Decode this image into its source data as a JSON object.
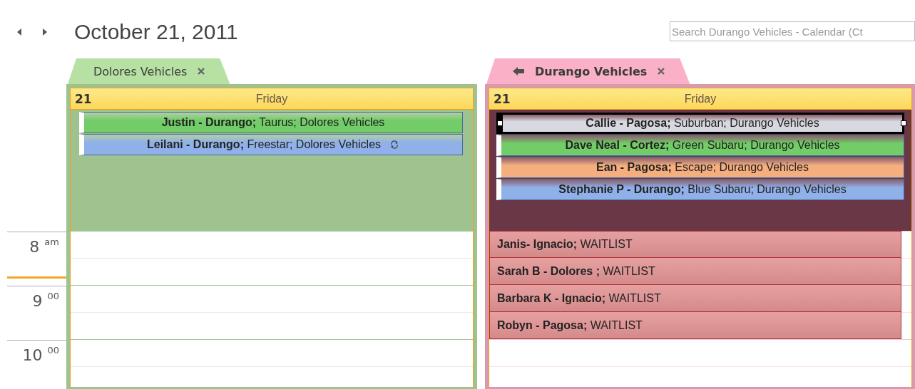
{
  "nav": {
    "title": "October 21, 2011"
  },
  "search": {
    "placeholder": "Search Durango Vehicles - Calendar (Ct"
  },
  "time_labels": [
    "8 $^{am}$",
    "9 $^{00}$",
    "10 $^{00}$"
  ],
  "calendars": [
    {
      "name": "Dolores Vehicles",
      "selected": false,
      "color": "#9fc38e",
      "day_number": "21",
      "day_name": "Friday",
      "all_day_selected": false,
      "all_day_events": [
        {
          "text": "**Justin - Durango;** Taurus; Dolores Vehicles",
          "color": "#72cc68",
          "selected": false,
          "recurring": false
        },
        {
          "text": "**Leilani - Durango;** Freestar; Dolores Vehicles",
          "color": "#8fb0e8",
          "selected": false,
          "recurring": true
        }
      ]
    },
    {
      "name": "Durango Vehicles",
      "selected": true,
      "color": "#d99aad",
      "day_number": "21",
      "day_name": "Friday",
      "all_day_selected": true,
      "all_day_events": [
        {
          "text": "**Callie - Pagosa;** Suburban; Durango Vehicles",
          "color": "#d8d8e0",
          "selected": true,
          "recurring": false
        },
        {
          "text": "**Dave Neal - Cortez;** Green Subaru; Durango Vehicles",
          "color": "#72cc68",
          "selected": false,
          "recurring": false
        },
        {
          "text": "**Ean - Pagosa;** Escape; Durango Vehicles",
          "color": "#f5ae7e",
          "selected": false,
          "recurring": false
        },
        {
          "text": "**Stephanie P - Durango;** Blue Subaru; Durango Vehicles",
          "color": "#8fb0e8",
          "selected": false,
          "recurring": false
        }
      ],
      "timed_events": [
        {
          "text": "**Janis- Ignacio;** WAITLIST",
          "color": "#e6a0a0"
        },
        {
          "text": "**Sarah B - Dolores ;** WAITLIST",
          "color": "#e6a0a0"
        },
        {
          "text": "**Barbara K - Ignacio;** WAITLIST",
          "color": "#e6a0a0"
        },
        {
          "text": "**Robyn - Pagosa;** WAITLIST",
          "color": "#e6a0a0"
        }
      ]
    }
  ]
}
